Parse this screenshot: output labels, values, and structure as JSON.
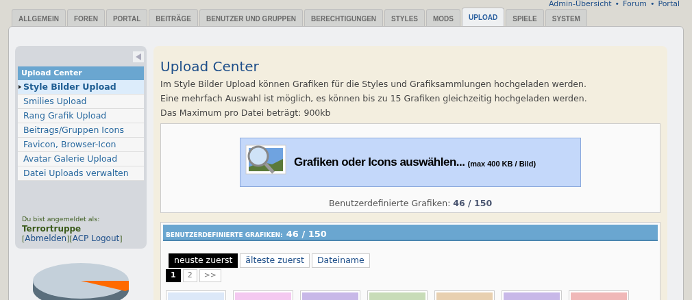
{
  "top_links": [
    "Admin-Übersicht",
    "Forum",
    "Portal"
  ],
  "top_link_separator": "•",
  "tabs": [
    {
      "label": "ALLGEMEIN",
      "selected": false
    },
    {
      "label": "FOREN",
      "selected": false
    },
    {
      "label": "PORTAL",
      "selected": false
    },
    {
      "label": "BEITRÄGE",
      "selected": false
    },
    {
      "label": "BENUTZER UND GRUPPEN",
      "selected": false
    },
    {
      "label": "BERECHTIGUNGEN",
      "selected": false
    },
    {
      "label": "STYLES",
      "selected": false
    },
    {
      "label": "MODS",
      "selected": false
    },
    {
      "label": "UPLOAD",
      "selected": true
    },
    {
      "label": "SPIELE",
      "selected": false
    },
    {
      "label": "SYSTEM",
      "selected": false
    }
  ],
  "sidebar": {
    "heading": "Upload Center",
    "items": [
      {
        "label": "Style Bilder Upload",
        "selected": true
      },
      {
        "label": "Smilies Upload",
        "selected": false
      },
      {
        "label": "Rang Grafik Upload",
        "selected": false
      },
      {
        "label": "Beitrags/Gruppen Icons",
        "selected": false
      },
      {
        "label": "Favicon, Browser-Icon",
        "selected": false
      },
      {
        "label": "Avatar Galerie Upload",
        "selected": false
      },
      {
        "label": "Datei Uploads verwalten",
        "selected": false
      }
    ],
    "login_label": "Du bist angemeldet als:",
    "username": "Terrortruppe",
    "logout_links": [
      {
        "open": "[",
        "label": "Abmelden",
        "close": "]"
      },
      {
        "open": "[",
        "label": "ACP Logout",
        "close": "]"
      }
    ]
  },
  "content": {
    "title": "Upload Center",
    "paragraphs": [
      "Im Style Bilder Upload können Grafiken für die Styles und Grafiksammlungen hochgeladen werden.",
      "Eine mehrfach Auswahl ist möglich, es können bis zu 15 Grafiken gleichzeitig hochgeladen werden.",
      "Das Maximum pro Datei beträgt: 900kb"
    ],
    "upload_button": {
      "label": "Grafiken oder Icons auswählen...",
      "note": "(max 400 KB / Bild)"
    },
    "count_label": "Benutzerdefinierte Grafiken:",
    "count": "46 / 150",
    "gallery": {
      "heading": "BENUTZERDEFINIERTE GRAFIKEN:",
      "count": "46 / 150",
      "sort_buttons": [
        {
          "label": "neuste zuerst",
          "selected": true
        },
        {
          "label": "älteste zuerst",
          "selected": false
        },
        {
          "label": "Dateiname",
          "selected": false
        }
      ],
      "pages": [
        {
          "label": "1",
          "selected": true
        },
        {
          "label": "2",
          "selected": false
        },
        {
          "label": ">>",
          "selected": false
        }
      ]
    }
  }
}
